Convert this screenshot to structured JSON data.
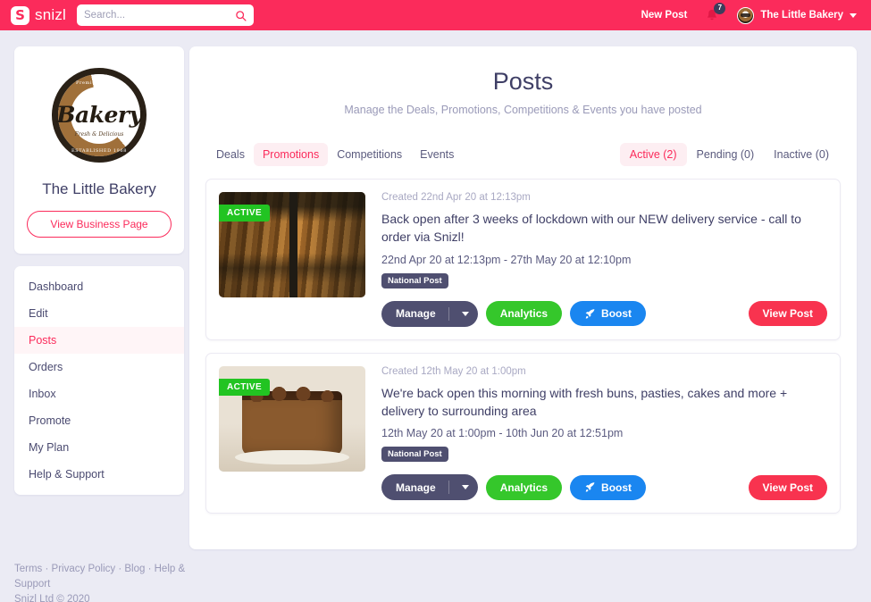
{
  "topnav": {
    "brand_mark": "S",
    "brand_word": "snizl",
    "search_placeholder": "Search...",
    "search_value": "",
    "new_post_label": "New Post",
    "notification_count": "7",
    "account_name": "The Little Bakery"
  },
  "sidebar": {
    "business_name": "The Little Bakery",
    "logo": {
      "word": "Bakery",
      "top_text": "Premium Quality",
      "middle_text": "Fresh & Delicious",
      "bottom_text": "ESTABLISHED 1968"
    },
    "view_business_label": "View Business Page",
    "items": [
      {
        "label": "Dashboard",
        "active": false
      },
      {
        "label": "Edit",
        "active": false
      },
      {
        "label": "Posts",
        "active": true
      },
      {
        "label": "Orders",
        "active": false
      },
      {
        "label": "Inbox",
        "active": false
      },
      {
        "label": "Promote",
        "active": false
      },
      {
        "label": "My Plan",
        "active": false
      },
      {
        "label": "Help & Support",
        "active": false
      }
    ]
  },
  "main": {
    "title": "Posts",
    "subtitle": "Manage the Deals, Promotions, Competitions & Events you have posted",
    "tabs": [
      {
        "label": "Deals",
        "active": false
      },
      {
        "label": "Promotions",
        "active": true
      },
      {
        "label": "Competitions",
        "active": false
      },
      {
        "label": "Events",
        "active": false
      }
    ],
    "filters": [
      {
        "label": "Active (2)",
        "active": true
      },
      {
        "label": "Pending (0)",
        "active": false
      },
      {
        "label": "Inactive (0)",
        "active": false
      }
    ],
    "posts": [
      {
        "status_badge": "ACTIVE",
        "created": "Created 22nd Apr 20 at 12:13pm",
        "text": "Back open after 3 weeks of lockdown with our NEW delivery service - call to order via Snizl!",
        "dates": "22nd Apr 20 at 12:13pm - 27th May 20 at 12:10pm",
        "scope_badge": "National Post",
        "image_alt": "baker-loading-bread-rack-photo",
        "buttons": {
          "manage": "Manage",
          "analytics": "Analytics",
          "boost": "Boost",
          "view": "View Post"
        }
      },
      {
        "status_badge": "ACTIVE",
        "created": "Created 12th May 20 at 1:00pm",
        "text": "We're back open this morning with fresh buns, pasties, cakes and more + delivery to surrounding area",
        "dates": "12th May 20 at 1:00pm - 10th Jun 20 at 12:51pm",
        "scope_badge": "National Post",
        "image_alt": "chocolate-drip-cake-photo",
        "buttons": {
          "manage": "Manage",
          "analytics": "Analytics",
          "boost": "Boost",
          "view": "View Post"
        }
      }
    ]
  },
  "footer": {
    "links": [
      {
        "label": "Terms"
      },
      {
        "label": "Privacy Policy"
      },
      {
        "label": "Blog"
      },
      {
        "label": "Help & Support"
      }
    ],
    "separator": " · ",
    "copyright": "Snizl Ltd © 2020"
  },
  "colors": {
    "brand_pink": "#fb2b5b",
    "active_green": "#22c422",
    "analytics_green": "#35c72b",
    "boost_blue": "#1a86f0",
    "view_red": "#f8334f",
    "slate": "#4f4f70",
    "page_bg": "#ebebf4"
  }
}
